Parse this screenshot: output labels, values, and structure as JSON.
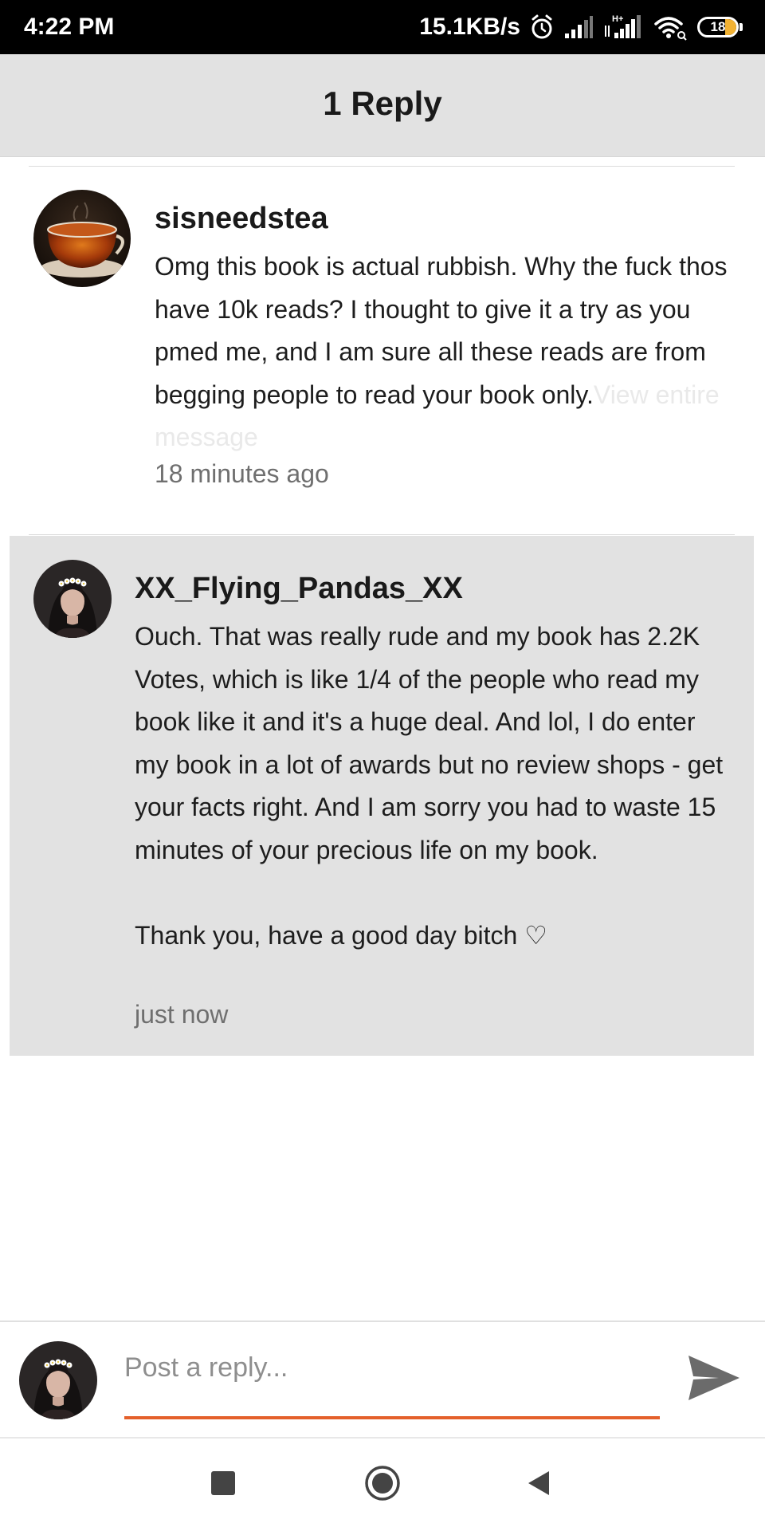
{
  "status_bar": {
    "time": "4:22 PM",
    "network_speed": "15.1KB/s",
    "battery_level": "18",
    "icons": [
      "alarm-icon",
      "signal-icon",
      "signal-h-plus-icon",
      "wifi-icon",
      "battery-icon"
    ]
  },
  "header": {
    "title": "1 Reply"
  },
  "original_comment": {
    "username": "sisneedstea",
    "avatar": "tea-cup-avatar",
    "body": "Omg this book is actual rubbish. Why the fuck thos have 10k reads? I thought to give it a try as you pmed me, and I am sure all these reads are from begging people to read your book only.",
    "view_more": "View entire message",
    "timestamp": "18 minutes ago"
  },
  "reply_comment": {
    "username": "XX_Flying_Pandas_XX",
    "avatar": "flower-crown-girl-avatar",
    "body": "Ouch. That was really rude and my book has 2.2K Votes, which is like 1/4 of the people who read my book like it and it's a huge deal. And lol, I do enter my book in a lot of awards but no review shops - get your facts right. And I am sorry you had to waste 15 minutes of your precious life on my book.\n\nThank you, have a good day bitch ♡",
    "timestamp": "just now"
  },
  "reply_bar": {
    "placeholder": "Post a reply...",
    "send_icon": "send-icon",
    "accent_color": "#e4602b"
  },
  "nav_bar": {
    "icons": [
      "recents-square-icon",
      "home-circle-icon",
      "back-triangle-icon"
    ]
  },
  "colors": {
    "status_bar_bg": "#000000",
    "header_bg": "#e2e2e2",
    "reply_highlight_bg": "#e2e2e2",
    "timestamp_text": "#6f6f6f",
    "view_more_text": "#e9e9e9"
  }
}
